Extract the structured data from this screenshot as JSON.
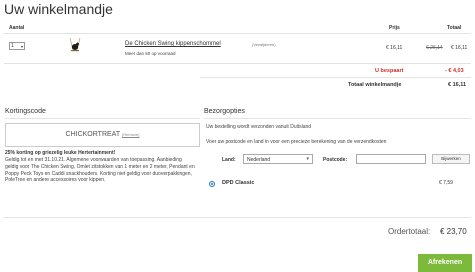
{
  "page": {
    "title": "Uw winkelmandje"
  },
  "cart": {
    "headers": {
      "quantity": "Aantal",
      "price": "Prijs",
      "total": "Totaal"
    },
    "item": {
      "quantity": "1",
      "name": "De Chicken Swing kippenschommel",
      "variant": "(Verwijderen)",
      "stock": "Meer dan 50 op voorraad",
      "price": "€ 16,11",
      "old_total": "€ 26,14",
      "total": "€ 16,11"
    },
    "savings": {
      "label": "U bespaart",
      "value": "- € 4,03"
    },
    "grand": {
      "label": "Totaal winkelmandje",
      "value": "€ 16,11"
    }
  },
  "coupon": {
    "heading": "Kortingscode",
    "code": "CHICKORTREAT",
    "remove_label": "(Remove)",
    "promo_title": "25% korting op griezelig leuke Hertertainment!",
    "promo_body": "Geldig tot en met 31.10.21. Algemene voorwaarden van toepassing. Aanbieding geldig voor The Chicken Swing, Omlet zitstokken van 1 meter en 2 meter, Pendant en Poppy Peck Toys en Caddi snackhouders. Korting niet geldig voor duoverpakkingen, PoleTree en andere accessoires voor kippen."
  },
  "shipping": {
    "heading": "Bezorgopties",
    "from_text": "Uw bestelling wordt verzonden vanuit Duitsland",
    "instruction": "Voer uw postcode en land in voor een precieze berekening van de verzendkosten",
    "country_label": "Land:",
    "country_value": "Nederland",
    "postcode_label": "Postcode:",
    "update_button": "Bijwerken",
    "option": {
      "name": "DPD Classic",
      "price": "€ 7,59",
      "selected": true
    }
  },
  "summary": {
    "label": "Ordertotaal:",
    "value": "€ 23,70"
  },
  "checkout": {
    "label": "Afrekenen"
  },
  "colors": {
    "accent_green": "#7db93a",
    "savings_red": "#c9302c",
    "radio_blue": "#1b6ac9"
  }
}
